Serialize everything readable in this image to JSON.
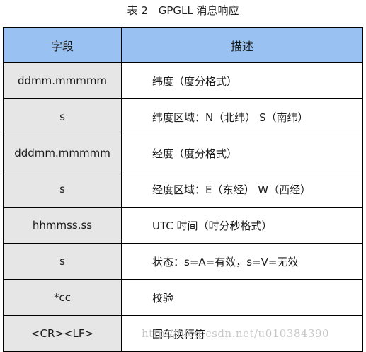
{
  "caption": "表 2　GPGLL 消息响应",
  "table": {
    "headers": [
      "字段",
      "描述"
    ],
    "rows": [
      {
        "field": "ddmm.mmmmm",
        "desc": "纬度（度分格式）"
      },
      {
        "field": "s",
        "desc": "纬度区域：N（北纬）  S（南纬）"
      },
      {
        "field": "dddmm.mmmmm",
        "desc": "经度（度分格式）"
      },
      {
        "field": "s",
        "desc": "经度区域：E（东经）  W（西经）"
      },
      {
        "field": "hhmmss.ss",
        "desc": "UTC 时间（时分秒格式）"
      },
      {
        "field": "s",
        "desc": "状态：s=A=有效，s=V=无效"
      },
      {
        "field": "*cc",
        "desc": "校验"
      },
      {
        "field": "<CR><LF>",
        "desc": "回车换行符"
      }
    ]
  },
  "watermark": "http://blog.csdn.net/u010384390"
}
